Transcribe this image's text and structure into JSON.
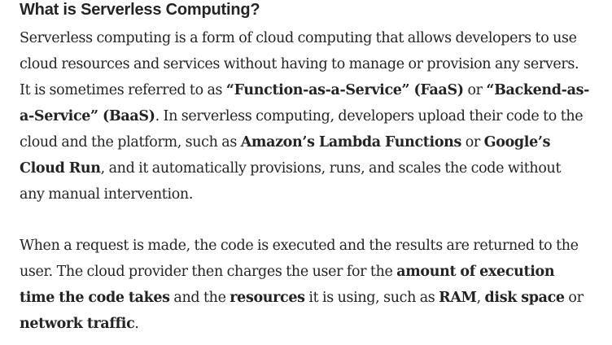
{
  "heading": "What is Serverless Computing?",
  "p1": {
    "t1": "Serverless computing is a form of cloud computing that allows developers to use cloud resources and services without having to manage or provision any servers. It is sometimes referred to as ",
    "b1": "“Function-as-a-Service” (FaaS)",
    "t2": " or ",
    "b2": "“Backend-as-a-Service” (BaaS)",
    "t3": ". In serverless computing, developers upload their code to the cloud and the platform, such as ",
    "b3": "Amazon’s Lambda Functions",
    "t4": " or ",
    "b4": "Google’s Cloud Run",
    "t5": ", and it automatically provisions, runs, and scales the code without any manual intervention."
  },
  "p2": {
    "t1": "When a request is made, the code is executed and the results are returned to the user. The cloud provider then charges the user for the ",
    "b1": "amount of execution time the code takes",
    "t2": " and the ",
    "b2": "resources",
    "t3": " it is using, such as ",
    "b3": "RAM",
    "t4": ", ",
    "b4": "disk space",
    "t5": " or ",
    "b5": "network traffic",
    "t6": "."
  }
}
